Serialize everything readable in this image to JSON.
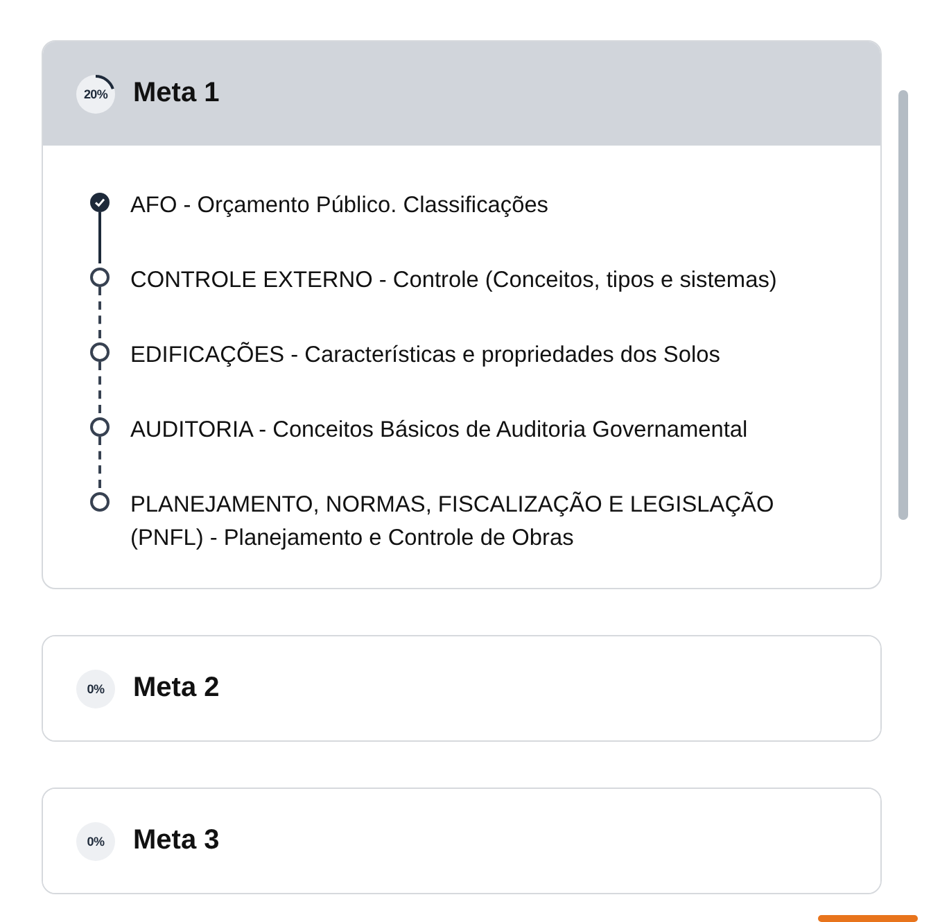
{
  "goals": [
    {
      "title": "Meta 1",
      "progress": "20%",
      "expanded": true,
      "topics": [
        {
          "text": "AFO - Orçamento Público. Classificações",
          "checked": true
        },
        {
          "text": "CONTROLE EXTERNO - Controle (Conceitos, tipos e sistemas)",
          "checked": false
        },
        {
          "text": "EDIFICAÇÕES - Características e propriedades dos Solos",
          "checked": false
        },
        {
          "text": "AUDITORIA - Conceitos Básicos de Auditoria Governamental",
          "checked": false
        },
        {
          "text": "PLANEJAMENTO, NORMAS, FISCALIZAÇÃO E LEGISLAÇÃO (PNFL) - Planejamento e Controle de Obras",
          "checked": false
        }
      ]
    },
    {
      "title": "Meta 2",
      "progress": "0%",
      "expanded": false
    },
    {
      "title": "Meta 3",
      "progress": "0%",
      "expanded": false
    }
  ]
}
